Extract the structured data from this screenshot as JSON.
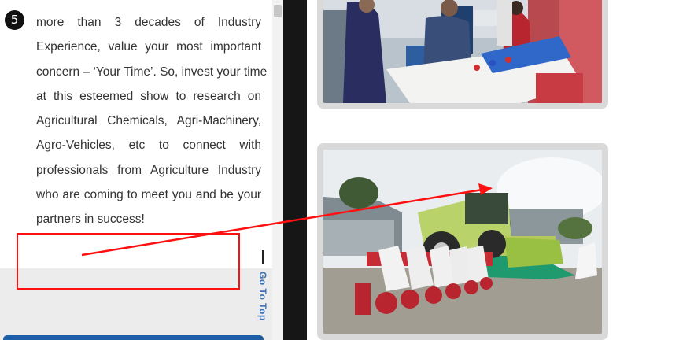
{
  "item": {
    "number": "5",
    "lines": [
      "more than 3 decades of Industry",
      "Experience, value your most important",
      "concern – ‘Your Time’. So, invest your time",
      "at this esteemed show to research on",
      "Agricultural Chemicals, Agri-Machinery,",
      "Agro-Vehicles, etc to connect with",
      "professionals from Agriculture Industry",
      "who are coming to meet you and be your",
      "partners in success!"
    ]
  },
  "go_to_top": {
    "label": "Go To Top"
  },
  "colors": {
    "annotation_red": "#ff1010",
    "badge_dark": "#111111",
    "link_blue": "#3b6fb6",
    "bar_blue": "#1d5fa8"
  },
  "icons": {
    "number_badge": "circled-number",
    "arrow": "annotation-arrow"
  }
}
